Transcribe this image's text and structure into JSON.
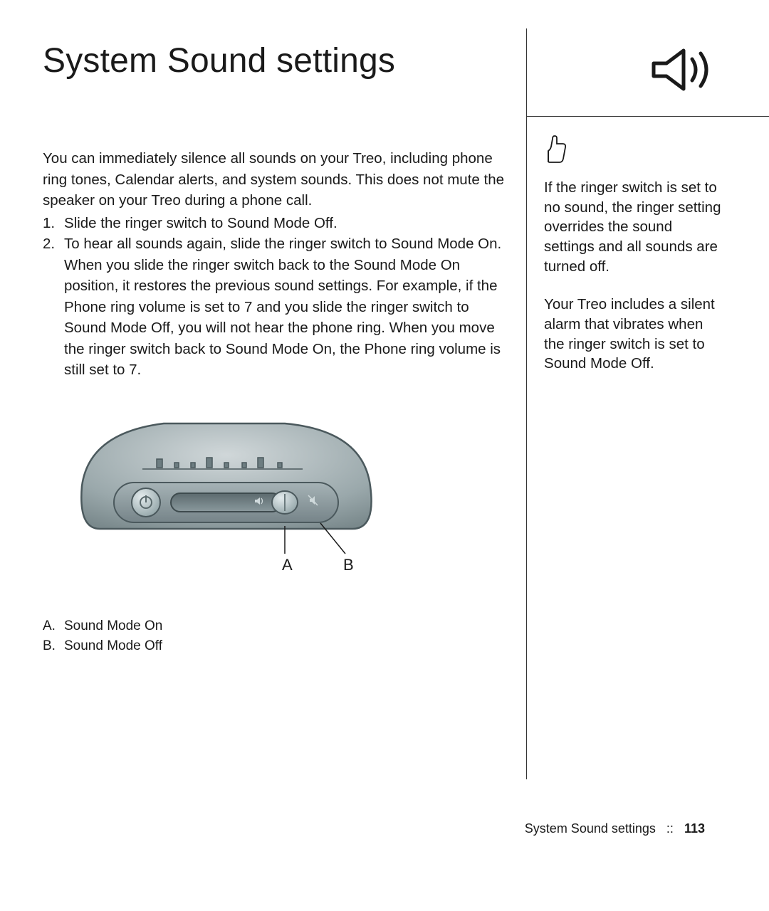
{
  "header": {
    "title": "System Sound settings"
  },
  "main": {
    "intro": "You can immediately silence all sounds on your Treo, including phone ring tones, Calendar alerts, and system sounds. This does not mute the speaker on your Treo during a phone call.",
    "steps": [
      "Slide the ringer switch to Sound Mode Off.",
      "To hear all sounds again, slide the ringer switch to Sound Mode On."
    ],
    "continuation": "When you slide the ringer switch back to the Sound Mode On position, it restores the previous sound settings. For example, if the Phone ring volume is set to 7 and you slide the ringer switch to Sound Mode Off, you will not hear the phone ring. When you move the ringer switch back to Sound Mode On, the Phone ring volume is still set to 7.",
    "diagram": {
      "label_a": "A",
      "label_b": "B"
    },
    "legend": {
      "a_letter": "A.",
      "a_text": "Sound Mode On",
      "b_letter": "B.",
      "b_text": "Sound Mode Off"
    }
  },
  "sidebar": {
    "tip1": "If the ringer switch is set to no sound, the ringer setting overrides the sound settings and all sounds are turned off.",
    "tip2": "Your Treo includes a silent alarm that vibrates when the ringer switch is set to Sound Mode Off."
  },
  "footer": {
    "section": "System Sound settings",
    "separator": "::",
    "page": "113"
  }
}
